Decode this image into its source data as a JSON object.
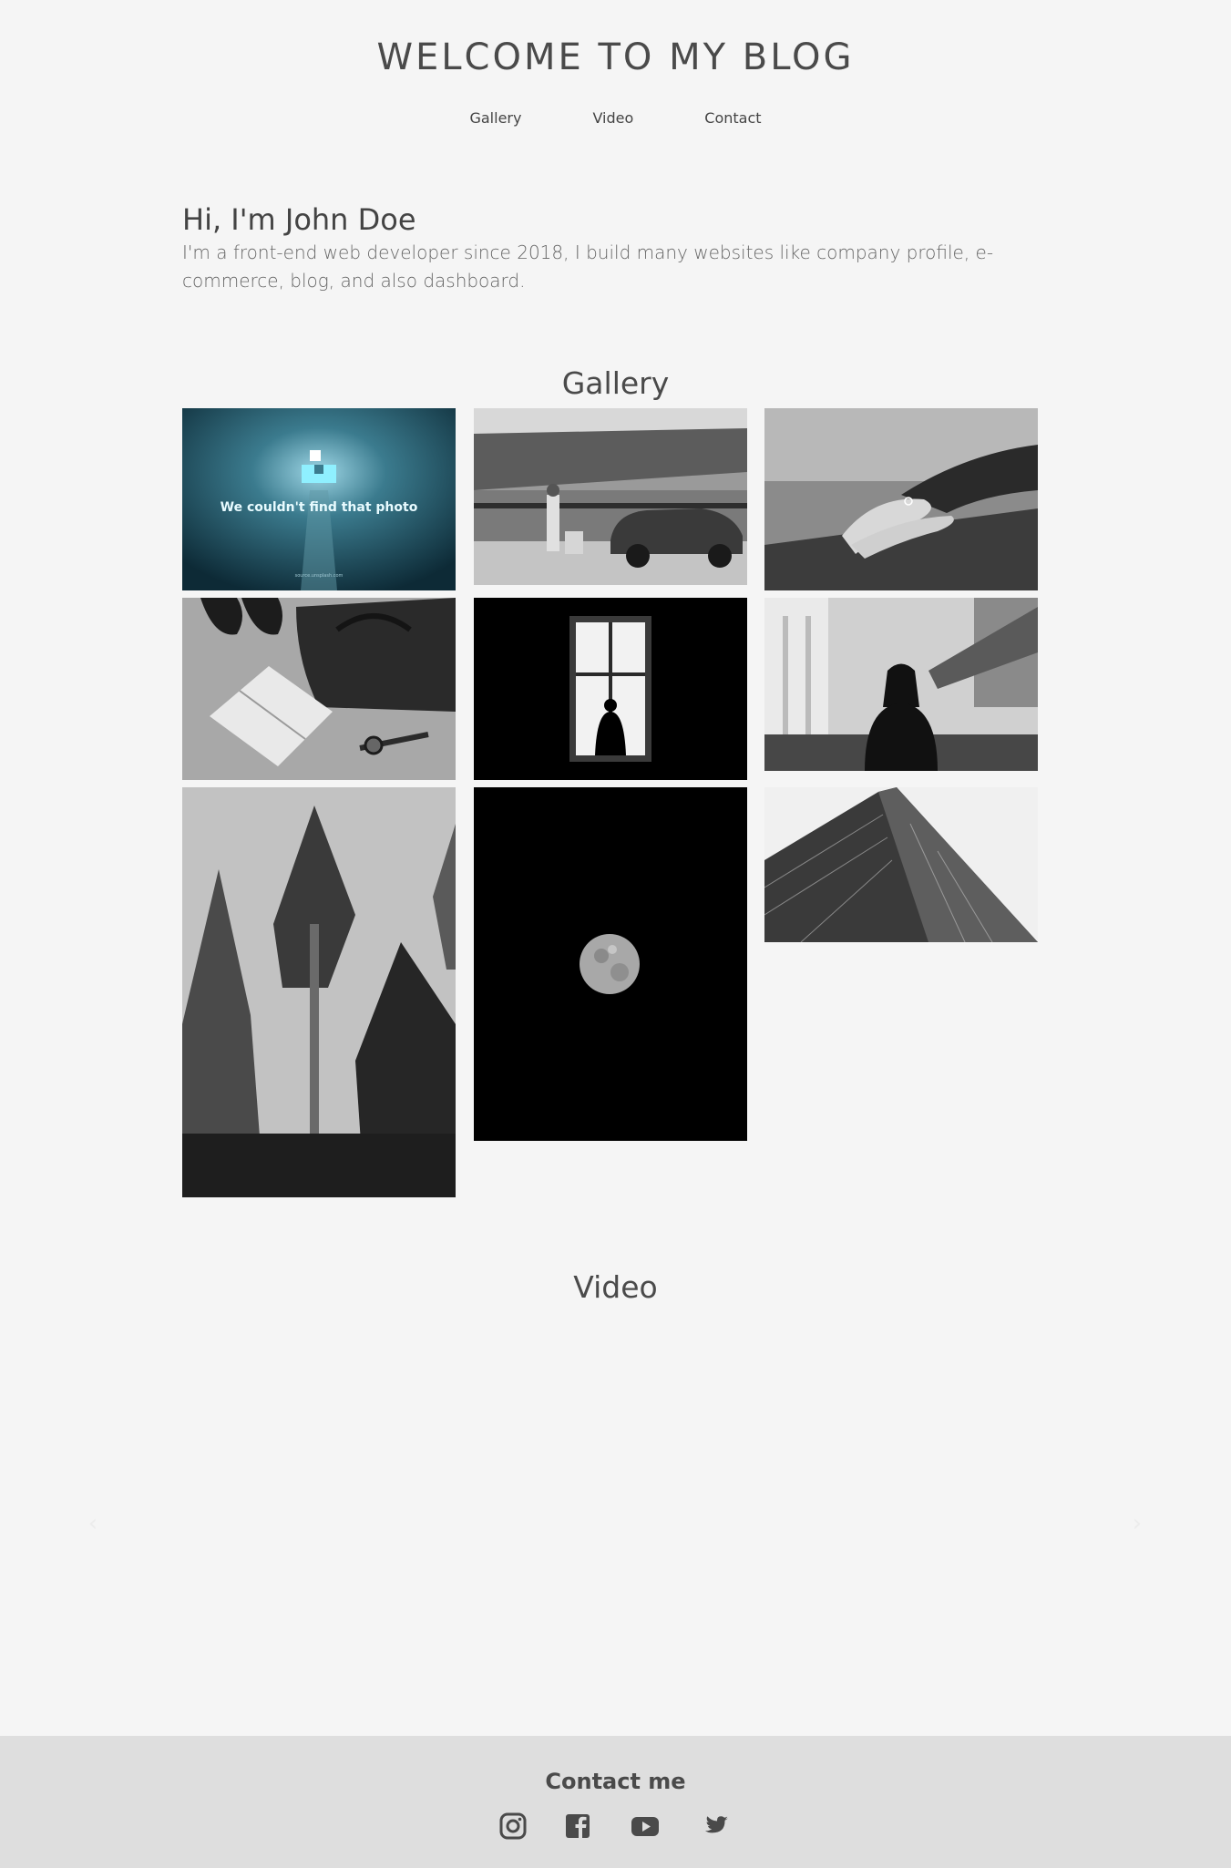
{
  "header": {
    "title": "WELCOME TO MY BLOG",
    "nav": [
      "Gallery",
      "Video",
      "Contact"
    ]
  },
  "intro": {
    "heading": "Hi, I'm John Doe",
    "text": "I'm a front-end web developer since 2018, I build many websites like company profile, e-commerce, blog, and also dashboard."
  },
  "gallery": {
    "title": "Gallery",
    "missing_photo_text": "We couldn't find that photo",
    "missing_photo_footer": "source.unsplash.com",
    "photos": [
      "missing-photo-placeholder",
      "man-with-vintage-car",
      "holding-hands-with-ring",
      "notebook-bag-shoes-watch",
      "person-silhouette-at-window",
      "woman-in-bright-hall",
      "tall-pine-forest",
      "full-moon-at-night",
      "glass-skyscraper"
    ]
  },
  "video": {
    "title": "Video",
    "prev_label": "‹",
    "next_label": "›"
  },
  "footer": {
    "title": "Contact me",
    "social": [
      "instagram-icon",
      "facebook-icon",
      "youtube-icon",
      "twitter-icon"
    ]
  },
  "colors": {
    "background": "#f5f5f5",
    "footer_background": "#dedede",
    "text": "#444444"
  }
}
